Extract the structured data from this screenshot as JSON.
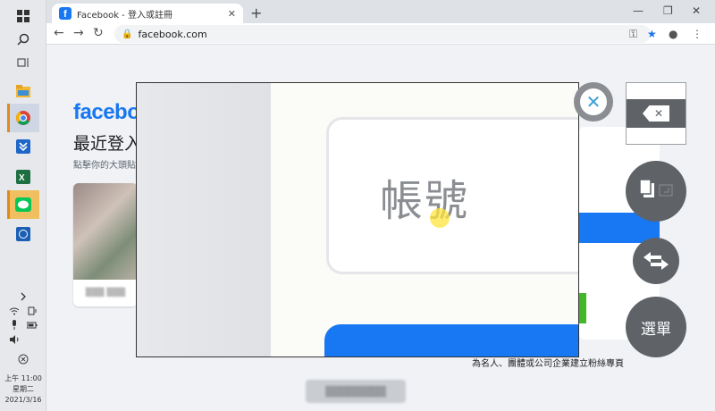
{
  "browser": {
    "tab_title": "Facebook - 登入或註冊",
    "tab_favicon": "f",
    "url": "facebook.com"
  },
  "page": {
    "logo": "faceboo",
    "recent_title": "最近登入",
    "recent_subtitle": "點擊你的大頭貼",
    "footer_link": "為名人、團體或公司企業建立粉絲專頁",
    "brand_blue": "#1877f2",
    "brand_green": "#42b72a"
  },
  "magnifier": {
    "field_label": "帳號"
  },
  "taskbar": {
    "time": "上午 11:00",
    "weekday": "星期二",
    "date": "2021/3/16"
  },
  "controls": {
    "menu_label": "選單"
  }
}
